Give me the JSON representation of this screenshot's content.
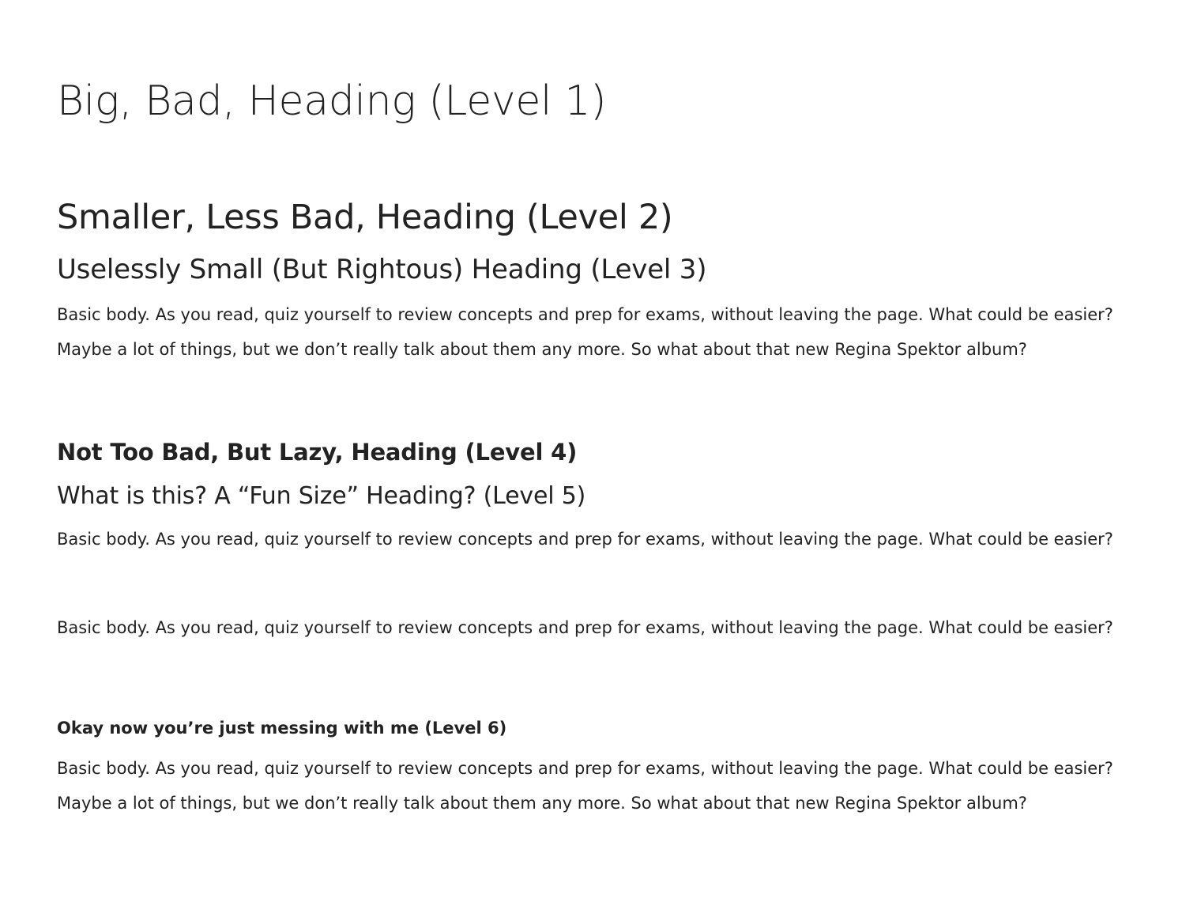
{
  "document": {
    "heading_1": "Big, Bad, Heading (Level 1)",
    "heading_2": "Smaller, Less Bad, Heading (Level 2)",
    "heading_3": "Uselessly Small (But Rightous) Heading (Level 3)",
    "paragraph_1": "Basic body. As you read, quiz yourself to review concepts and prep for exams, without leaving the page. What could be easier? Maybe a lot of things, but we don’t really talk about them any more. So what about that new Regina Spektor album?",
    "heading_4": "Not Too Bad, But Lazy, Heading (Level 4)",
    "heading_5": "What is this? A “Fun Size” Heading? (Level 5)",
    "paragraph_2": "Basic body. As you read, quiz yourself to review concepts and prep for exams, without leaving the page. What could be easier?",
    "paragraph_3": "Basic body. As you read, quiz yourself to review concepts and prep for exams, without leaving the page. What could be easier?",
    "heading_6": "Okay now you’re just messing with me (Level 6)",
    "paragraph_4": "Basic body. As you read, quiz yourself to review concepts and prep for exams, without leaving the page. What could be easier? Maybe a lot of things, but we don’t really talk about them any more. So what about that new Regina Spektor album?"
  },
  "colors": {
    "text": "#222222",
    "background": "#ffffff"
  }
}
